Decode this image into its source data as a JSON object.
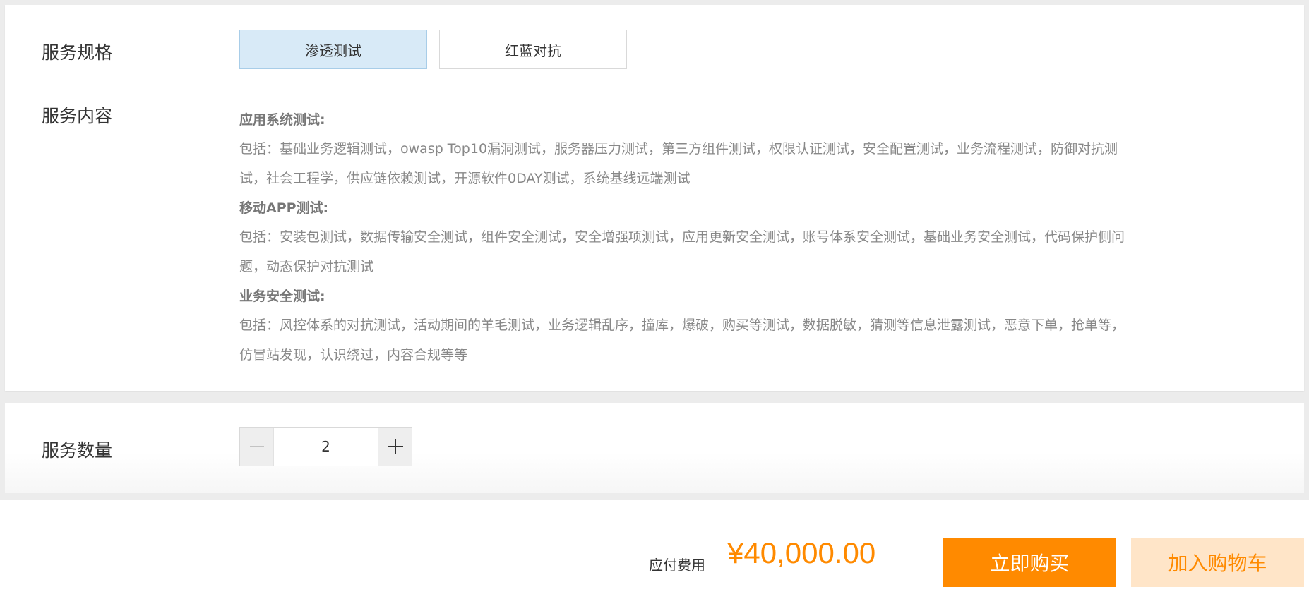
{
  "spec": {
    "label": "服务规格",
    "options": [
      {
        "label": "渗透测试",
        "selected": true
      },
      {
        "label": "红蓝对抗",
        "selected": false
      }
    ]
  },
  "content": {
    "label": "服务内容",
    "groups": [
      {
        "heading": "应用系统测试:",
        "description": "包括：基础业务逻辑测试，owasp Top10漏洞测试，服务器压力测试，第三方组件测试，权限认证测试，安全配置测试，业务流程测试，防御对抗测试，社会工程学，供应链依赖测试，开源软件0DAY测试，系统基线远端测试"
      },
      {
        "heading": "移动APP测试:",
        "description": "包括：安装包测试，数据传输安全测试，组件安全测试，安全增强项测试，应用更新安全测试，账号体系安全测试，基础业务安全测试，代码保护侧问题，动态保护对抗测试"
      },
      {
        "heading": "业务安全测试:",
        "description": "包括：风控体系的对抗测试，活动期间的羊毛测试，业务逻辑乱序，撞库，爆破，购买等测试，数据脱敏，猜测等信息泄露测试，恶意下单，抢单等，仿冒站发现，认识绕过，内容合规等等"
      }
    ]
  },
  "quantity": {
    "label": "服务数量",
    "value": "2",
    "minus_icon": "minus-icon",
    "plus_icon": "plus-icon"
  },
  "footer": {
    "fee_label": "应付费用",
    "fee_amount": "¥40,000.00",
    "buy_label": "立即购买",
    "cart_label": "加入购物车"
  },
  "colors": {
    "accent": "#ff8a00",
    "accent_light": "#ffe5c8",
    "selected_bg": "#d8eaf7",
    "selected_border": "#a8cde8"
  }
}
